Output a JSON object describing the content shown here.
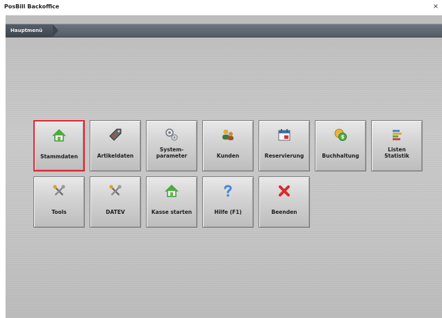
{
  "window": {
    "title": "PosBill Backoffice",
    "close_glyph": "×"
  },
  "breadcrumb": {
    "current": "Hauptmenü"
  },
  "menu": {
    "tiles": [
      {
        "key": "stammdaten",
        "label": "Stammdaten",
        "icon": "house-icon",
        "selected": true
      },
      {
        "key": "artikeldaten",
        "label": "Artikeldaten",
        "icon": "tag-icon"
      },
      {
        "key": "systemparameter",
        "label": "System-\nparameter",
        "icon": "gears-icon"
      },
      {
        "key": "kunden",
        "label": "Kunden",
        "icon": "customers-icon"
      },
      {
        "key": "reservierung",
        "label": "Reservierung",
        "icon": "calendar-icon"
      },
      {
        "key": "buchhaltung",
        "label": "Buchhaltung",
        "icon": "coins-icon"
      },
      {
        "key": "listen",
        "label": "Listen\nStatistik",
        "icon": "statistics-icon"
      },
      {
        "key": "tools",
        "label": "Tools",
        "icon": "tools-icon"
      },
      {
        "key": "datev",
        "label": "DATEV",
        "icon": "tools-icon"
      },
      {
        "key": "kasse",
        "label": "Kasse starten",
        "icon": "house-icon"
      },
      {
        "key": "hilfe",
        "label": "Hilfe (F1)",
        "icon": "help-icon"
      },
      {
        "key": "beenden",
        "label": "Beenden",
        "icon": "close-x-icon"
      }
    ]
  },
  "colors": {
    "selected_border": "#e2202a",
    "breadcrumb_bg": "#545c66"
  }
}
